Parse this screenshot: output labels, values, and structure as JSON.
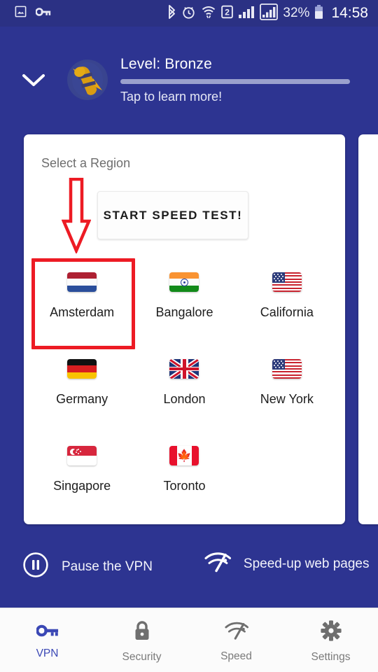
{
  "theme": {
    "brand_blue": "#2d3491",
    "statusbar_blue": "#2b3184",
    "accent_blue": "#3b48b5",
    "annotation_red": "#ed1b24",
    "card_white": "#ffffff"
  },
  "statusbar": {
    "icons_left": [
      "image-icon",
      "key-icon"
    ],
    "icons_right": [
      "bluetooth-icon",
      "alarm-icon",
      "wifi-icon",
      "sim-2-icon",
      "signal-bars-icon",
      "signal-bars-boxed-icon"
    ],
    "battery_percent": "32%",
    "battery_icon": "battery-icon",
    "time": "14:58"
  },
  "header": {
    "collapse_icon": "chevron-down-icon",
    "mascot_icon": "bee-mascot-icon",
    "level_title": "Level: Bronze",
    "progress_percent": 100,
    "subtitle": "Tap to learn more!"
  },
  "card": {
    "section_label": "Select a Region",
    "speed_test_button": "START SPEED TEST!",
    "regions": [
      {
        "name": "Amsterdam",
        "flag": "netherlands-flag-icon",
        "selected": true
      },
      {
        "name": "Bangalore",
        "flag": "india-flag-icon",
        "selected": false
      },
      {
        "name": "California",
        "flag": "usa-flag-icon",
        "selected": false
      },
      {
        "name": "Germany",
        "flag": "germany-flag-icon",
        "selected": false
      },
      {
        "name": "London",
        "flag": "uk-flag-icon",
        "selected": false
      },
      {
        "name": "New York",
        "flag": "usa-flag-icon",
        "selected": false
      },
      {
        "name": "Singapore",
        "flag": "singapore-flag-icon",
        "selected": false
      },
      {
        "name": "Toronto",
        "flag": "canada-flag-icon",
        "selected": false
      }
    ]
  },
  "annotations": {
    "arrow": "red-down-arrow pointing at Amsterdam region tile",
    "highlight_box": "red rectangle around Amsterdam region tile"
  },
  "actions": [
    {
      "label": "Pause the VPN",
      "icon": "pause-circle-icon"
    },
    {
      "label": "Speed-up web pages",
      "icon": "speed-icon"
    }
  ],
  "bottom_nav": [
    {
      "label": "VPN",
      "icon": "key-icon",
      "active": true
    },
    {
      "label": "Security",
      "icon": "lock-icon",
      "active": false
    },
    {
      "label": "Speed",
      "icon": "speed-icon",
      "active": false
    },
    {
      "label": "Settings",
      "icon": "gear-icon",
      "active": false
    }
  ]
}
